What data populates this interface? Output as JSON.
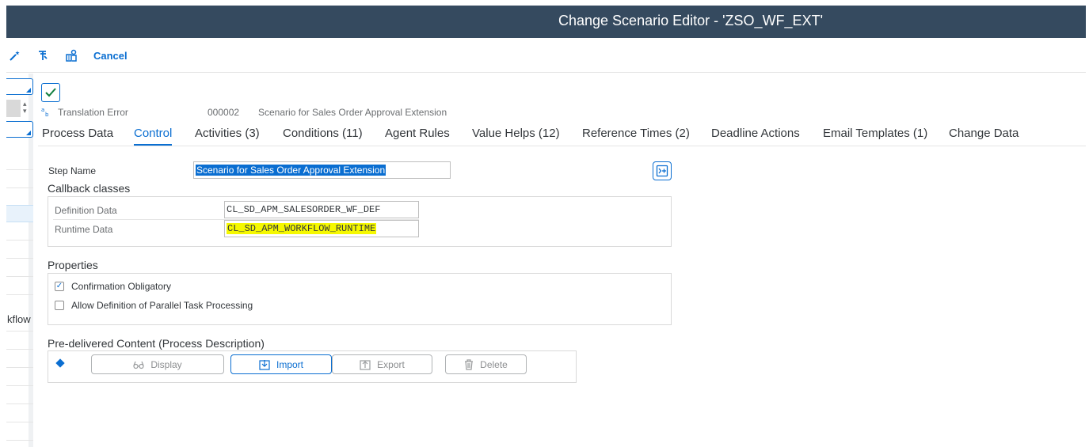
{
  "window": {
    "title": "Change Scenario Editor - 'ZSO_WF_EXT'"
  },
  "toolbar": {
    "icons": [
      "magic-wand-icon",
      "filter-icon",
      "object-settings-icon"
    ],
    "cancel_label": "Cancel"
  },
  "left_panel": {
    "partial_text": "kflow"
  },
  "status": {
    "translation_label": "Translation Error",
    "scenario_number": "000002",
    "scenario_description": "Scenario for Sales Order Approval Extension"
  },
  "tabs": [
    {
      "label": "Process Data",
      "active": false
    },
    {
      "label": "Control",
      "active": true
    },
    {
      "label": "Activities (3)",
      "active": false
    },
    {
      "label": "Conditions (11)",
      "active": false
    },
    {
      "label": "Agent Rules",
      "active": false
    },
    {
      "label": "Value Helps (12)",
      "active": false
    },
    {
      "label": "Reference Times (2)",
      "active": false
    },
    {
      "label": "Deadline Actions",
      "active": false
    },
    {
      "label": "Email Templates (1)",
      "active": false
    },
    {
      "label": "Change Data",
      "active": false
    }
  ],
  "control": {
    "step_name_label": "Step Name",
    "step_name_value": "Scenario for Sales Order Approval Extension",
    "callback_title": "Callback classes",
    "definition_label": "Definition Data",
    "definition_value": "CL_SD_APM_SALESORDER_WF_DEF",
    "runtime_label": "Runtime Data",
    "runtime_value": "CL_SD_APM_WORKFLOW_RUNTIME",
    "properties_title": "Properties",
    "confirmation_label": "Confirmation Obligatory",
    "confirmation_checked": true,
    "parallel_label": "Allow Definition of Parallel Task Processing",
    "parallel_checked": false,
    "predelivered_title": "Pre-delivered Content (Process Description)",
    "buttons": {
      "display": "Display",
      "import": "Import",
      "export": "Export",
      "delete": "Delete"
    }
  },
  "colors": {
    "header_bg": "#354a5f",
    "accent": "#0a6ed1",
    "highlight": "#f5f800"
  }
}
